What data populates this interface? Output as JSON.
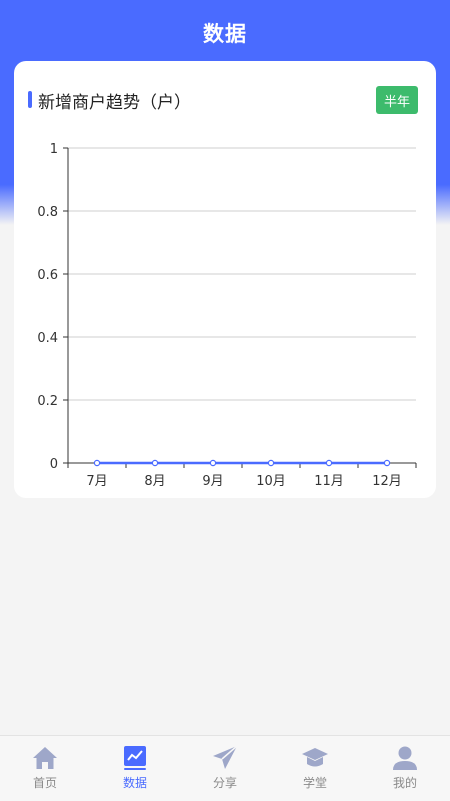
{
  "header": {
    "title": "数据"
  },
  "card": {
    "title": "新增商户趋势（户）",
    "period_button": "半年",
    "accent_color": "#4a6bff",
    "button_color": "#3dbb6c"
  },
  "chart_data": {
    "type": "line",
    "title": "新增商户趋势（户）",
    "categories": [
      "7月",
      "8月",
      "9月",
      "10月",
      "11月",
      "12月"
    ],
    "series": [
      {
        "values": [
          0,
          0,
          0,
          0,
          0,
          0
        ]
      }
    ],
    "y_ticks": [
      "0",
      "0.2",
      "0.4",
      "0.6",
      "0.8",
      "1"
    ],
    "ylim": [
      0,
      1
    ],
    "grid": true,
    "line_color": "#4a6bff"
  },
  "tabbar": {
    "items": [
      {
        "label": "首页",
        "icon": "home-icon",
        "active": false
      },
      {
        "label": "数据",
        "icon": "chart-icon",
        "active": true
      },
      {
        "label": "分享",
        "icon": "paper-plane-icon",
        "active": false
      },
      {
        "label": "学堂",
        "icon": "graduation-cap-icon",
        "active": false
      },
      {
        "label": "我的",
        "icon": "user-icon",
        "active": false
      }
    ]
  }
}
